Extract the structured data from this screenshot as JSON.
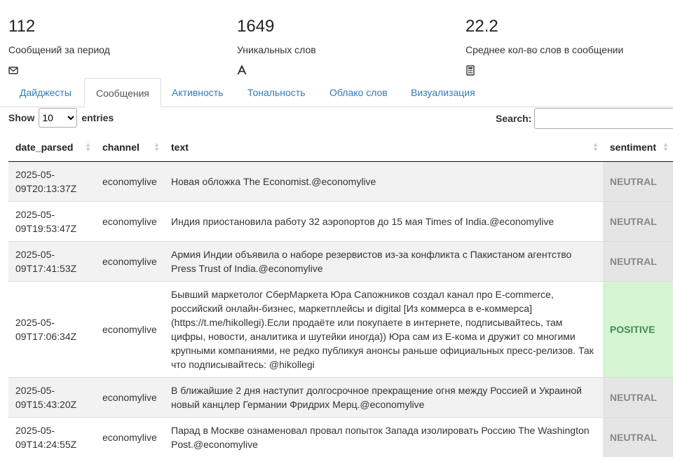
{
  "stats": [
    {
      "value": "112",
      "label": "Сообщений за период",
      "icon": "envelope-icon"
    },
    {
      "value": "1649",
      "label": "Уникальных слов",
      "icon": "font-icon"
    },
    {
      "value": "22.2",
      "label": "Среднее кол-во слов в сообщении",
      "icon": "calculator-icon"
    }
  ],
  "tabs": [
    "Дайджесты",
    "Сообщения",
    "Активность",
    "Тональность",
    "Облако слов",
    "Визуализация"
  ],
  "active_tab": "Сообщения",
  "controls": {
    "show_label": "Show",
    "entries_value": "10",
    "entries_label": "entries",
    "search_label": "Search:",
    "search_value": ""
  },
  "table": {
    "headers": [
      "date_parsed",
      "channel",
      "text",
      "sentiment"
    ],
    "rows": [
      {
        "date_line1": "2025-05-",
        "date_line2": "09T20:13:37Z",
        "channel": "economylive",
        "text": "Новая обложка The Economist.@economylive",
        "sentiment": "NEUTRAL"
      },
      {
        "date_line1": "2025-05-",
        "date_line2": "09T19:53:47Z",
        "channel": "economylive",
        "text": "Индия приостановила работу 32 аэропортов до 15 мая Times of India.@economylive",
        "sentiment": "NEUTRAL"
      },
      {
        "date_line1": "2025-05-",
        "date_line2": "09T17:41:53Z",
        "channel": "economylive",
        "text": "Армия Индии объявила о наборе резервистов из-за конфликта с Пакистаном агентство Press Trust of India.@economylive",
        "sentiment": "NEUTRAL"
      },
      {
        "date_line1": "2025-05-",
        "date_line2": "09T17:06:34Z",
        "channel": "economylive",
        "text": "Бывший маркетолог СберМаркета Юра Сапожников создал канал про E-commerce, российский онлайн-бизнес, маркетплейсы и digital [Из коммерса в е-коммерса](https://t.me/hikollegi).Если продаёте или покупаете в интернете, подписывайтесь, там цифры, новости, аналитика и шутейки иногда)) Юра сам из Е-кома и дружит со многими крупными компаниями, не редко публикуя анонсы раньше официальных пресс-релизов. Так что подписывайтесь: @hikollegi",
        "sentiment": "POSITIVE"
      },
      {
        "date_line1": "2025-05-",
        "date_line2": "09T15:43:20Z",
        "channel": "economylive",
        "text": "В ближайшие 2 дня наступит долгосрочное прекращение огня между Россией и Украиной новый канцлер Германии Фридрих Мерц.@economylive",
        "sentiment": "NEUTRAL"
      },
      {
        "date_line1": "2025-05-",
        "date_line2": "09T14:24:55Z",
        "channel": "economylive",
        "text": "Парад в Москве ознаменовал провал попыток Запада изолировать Россию The Washington Post.@economylive",
        "sentiment": "NEUTRAL"
      }
    ]
  }
}
